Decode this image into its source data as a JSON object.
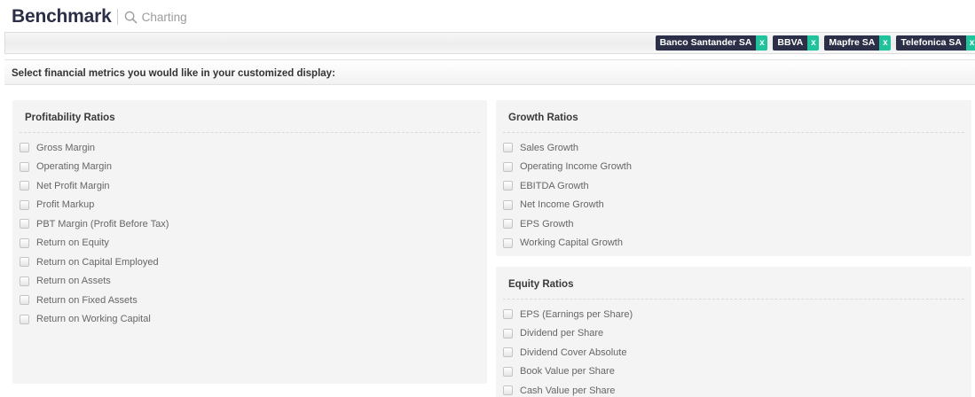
{
  "header": {
    "title": "Benchmark",
    "charting_label": "Charting"
  },
  "companies": [
    "Banco Santander SA",
    "BBVA",
    "Mapfre SA",
    "Telefonica SA"
  ],
  "tag_close_label": "x",
  "instruction": "Select financial metrics you would like in your customized display:",
  "sections": {
    "profitability": {
      "title": "Profitability Ratios",
      "items": [
        "Gross Margin",
        "Operating Margin",
        "Net Profit Margin",
        "Profit Markup",
        "PBT Margin (Profit Before Tax)",
        "Return on Equity",
        "Return on Capital Employed",
        "Return on Assets",
        "Return on Fixed Assets",
        "Return on Working Capital"
      ]
    },
    "growth": {
      "title": "Growth Ratios",
      "items": [
        "Sales Growth",
        "Operating Income Growth",
        "EBITDA Growth",
        "Net Income Growth",
        "EPS Growth",
        "Working Capital Growth"
      ]
    },
    "equity": {
      "title": "Equity Ratios",
      "items": [
        "EPS (Earnings per Share)",
        "Dividend per Share",
        "Dividend Cover Absolute",
        "Book Value per Share",
        "Cash Value per Share"
      ]
    }
  },
  "colors": {
    "brand": "#2c2f48",
    "accent": "#20c39b"
  }
}
